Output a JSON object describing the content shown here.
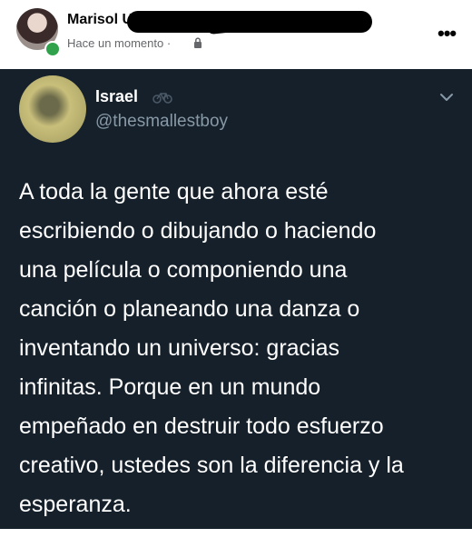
{
  "post": {
    "author_name": "Marisol U",
    "timestamp": "Hace un momento",
    "separator": "·",
    "privacy_icon": "lock-icon",
    "more_icon": "more-options-icon",
    "more_glyph": "•••"
  },
  "tweet": {
    "display_name": "Israel",
    "handle": "@thesmallestboy",
    "badge_icon": "bicycle-emoji-icon",
    "menu_icon": "chevron-down-icon",
    "text_lines": [
      "A toda la gente que ahora esté",
      "escribiendo o dibujando o haciendo",
      "una película o componiendo una",
      "canción o planeando una danza o",
      "inventando un universo: gracias",
      "infinitas. Porque en un mundo",
      "empeñado en destruir todo esfuerzo",
      "creativo, ustedes son la diferencia y la",
      "esperanza."
    ]
  },
  "colors": {
    "tweet_background": "#15202b",
    "handle_gray": "#8899a6",
    "online_green": "#31a24c",
    "meta_gray": "#65676b"
  }
}
